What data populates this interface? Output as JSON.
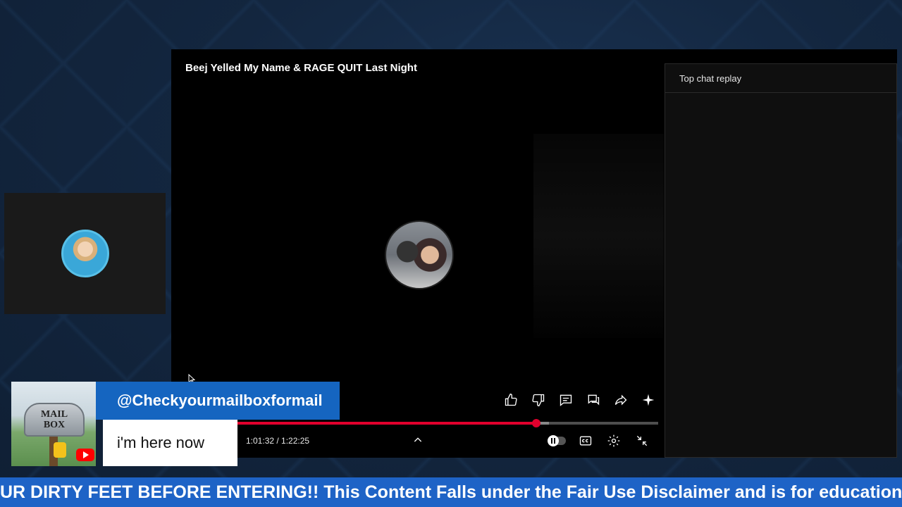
{
  "video": {
    "title": "Beej Yelled My Name & RAGE QUIT Last Night",
    "current_time": "1:01:32",
    "duration": "1:22:25",
    "time_display": "1:01:32 / 1:22:25",
    "progress_fraction": 0.71,
    "buffered_fraction": 0.74
  },
  "chat": {
    "header": "Top chat replay"
  },
  "actions": [
    {
      "name": "like-icon"
    },
    {
      "name": "dislike-icon"
    },
    {
      "name": "comments-icon"
    },
    {
      "name": "live-chat-icon"
    },
    {
      "name": "share-icon"
    },
    {
      "name": "sparkle-icon"
    }
  ],
  "controls": [
    {
      "name": "autoplay-toggle"
    },
    {
      "name": "captions-icon"
    },
    {
      "name": "settings-icon"
    },
    {
      "name": "exit-fullscreen-icon"
    }
  ],
  "chat_card": {
    "username": "@Checkyourmailboxformail",
    "message": "i'm here now",
    "mailbox_text_line1": "MAIL",
    "mailbox_text_line2": "BOX"
  },
  "ticker": {
    "text": "UR DIRTY FEET BEFORE ENTERING!! This Content Falls under the Fair Use Disclaimer and is for educationa"
  },
  "colors": {
    "accent_red": "#e1002d",
    "card_blue": "#1565c0",
    "ticker_blue": "#1e63c6"
  }
}
